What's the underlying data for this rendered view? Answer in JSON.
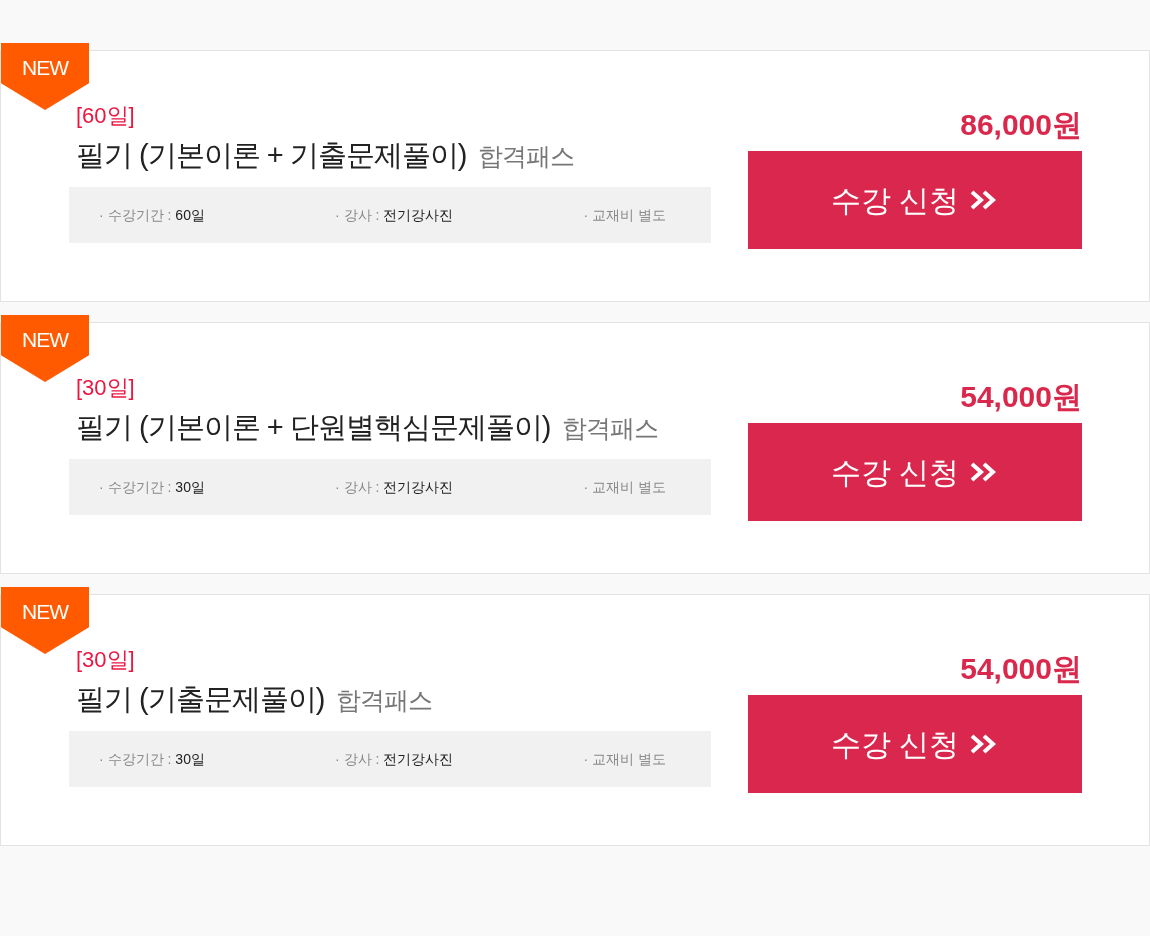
{
  "courses": [
    {
      "badge": "NEW",
      "period": "[60일]",
      "title": "필기 (기본이론 + 기출문제풀이)",
      "subtitle": "합격패스",
      "info": [
        {
          "label": "· 수강기간 :",
          "value": "60일"
        },
        {
          "label": "· 강사 :",
          "value": "전기강사진"
        },
        {
          "label": "· 교재비 별도"
        }
      ],
      "price": "86,000원",
      "button": "수강 신청"
    },
    {
      "badge": "NEW",
      "period": "[30일]",
      "title": "필기 (기본이론 + 단원별핵심문제풀이)",
      "subtitle": "합격패스",
      "info": [
        {
          "label": "· 수강기간 :",
          "value": "30일"
        },
        {
          "label": "· 강사 :",
          "value": "전기강사진"
        },
        {
          "label": "· 교재비 별도"
        }
      ],
      "price": "54,000원",
      "button": "수강 신청"
    },
    {
      "badge": "NEW",
      "period": "[30일]",
      "title": "필기 (기출문제풀이)",
      "subtitle": "합격패스",
      "info": [
        {
          "label": "· 수강기간 :",
          "value": "30일"
        },
        {
          "label": "· 강사 :",
          "value": "전기강사진"
        },
        {
          "label": "· 교재비 별도"
        }
      ],
      "price": "54,000원",
      "button": "수강 신청"
    }
  ]
}
